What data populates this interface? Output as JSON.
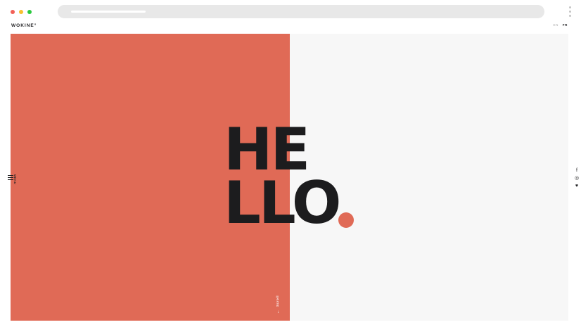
{
  "browser": {
    "window_controls": [
      "close",
      "minimize",
      "maximize"
    ],
    "menu_icon": "kebab-menu-icon"
  },
  "header": {
    "logo": "WOKINE°",
    "languages": [
      {
        "label": "EN",
        "active": false
      },
      {
        "label": "FR",
        "active": true
      }
    ]
  },
  "hero": {
    "line1": "HE",
    "line2": "LLO",
    "accent_color": "#e06a56",
    "text_color": "#1c1c1e"
  },
  "nav": {
    "menu_label": "MENU",
    "menu_icon": "hamburger-icon"
  },
  "social": [
    {
      "name": "facebook-icon",
      "glyph": "f"
    },
    {
      "name": "instagram-icon",
      "glyph": "◎"
    },
    {
      "name": "twitter-icon",
      "glyph": "♥"
    }
  ],
  "scroll": {
    "label": "Scroll",
    "arrow": "↓"
  },
  "colors": {
    "left_panel": "#e06a56",
    "right_panel": "#f7f7f7"
  }
}
